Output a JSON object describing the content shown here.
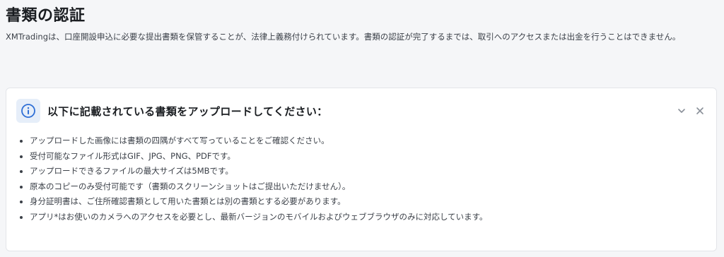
{
  "page": {
    "title": "書類の認証",
    "description": "XMTradingは、口座開設申込に必要な提出書類を保管することが、法律上義務付けられています。書類の認証が完了するまでは、取引へのアクセスまたは出金を行うことはできません。"
  },
  "notice": {
    "title": "以下に記載されている書類をアップロードしてください：",
    "icon": "info-icon",
    "actions": {
      "collapse_icon": "chevron-down-icon",
      "close_icon": "close-icon"
    },
    "items": [
      "アップロードした画像には書類の四隅がすべて写っていることをご確認ください。",
      "受付可能なファイル形式はGIF、JPG、PNG、PDFです。",
      "アップロードできるファイルの最大サイズは5MBです。",
      "原本のコピーのみ受付可能です（書類のスクリーンショットはご提出いただけません）。",
      "身分証明書は、ご住所確認書類として用いた書類とは別の書類とする必要があります。",
      "アプリ*はお使いのカメラへのアクセスを必要とし、最新バージョンのモバイルおよびウェブブラウザのみに対応しています。"
    ]
  },
  "colors": {
    "page_background": "#f5f6f8",
    "card_background": "#ffffff",
    "info_accent": "#2f6fd6",
    "info_badge_background": "#e6eef9"
  }
}
